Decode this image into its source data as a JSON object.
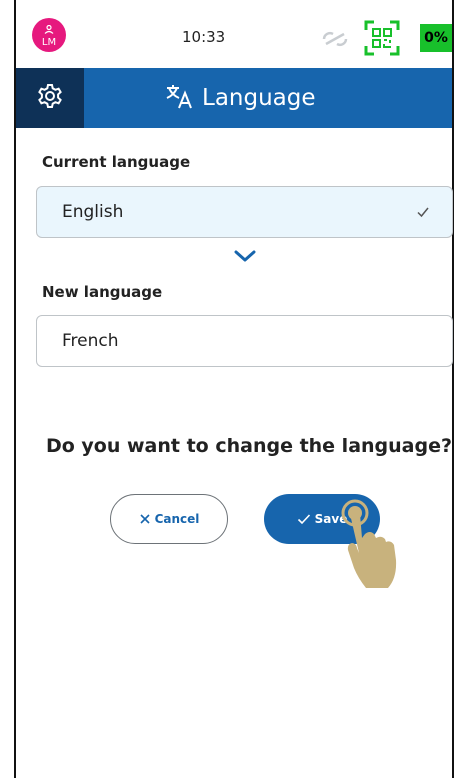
{
  "status_bar": {
    "avatar_initials": "LM",
    "time": "10:33",
    "battery": "0%",
    "battery_color": "#18c02b",
    "avatar_color": "#e6197e",
    "sync_icon": "sync-disconnected-icon",
    "qr_icon": "qr-scan-icon"
  },
  "header": {
    "title": "Language",
    "settings_icon": "gear-icon",
    "title_icon": "translate-icon",
    "background": "#1765ad"
  },
  "form": {
    "current_label": "Current language",
    "current_value": "English",
    "new_label": "New language",
    "new_value": "French"
  },
  "question": "Do you want to change the language?",
  "buttons": {
    "cancel_label": "Cancel",
    "save_label": "Save"
  }
}
